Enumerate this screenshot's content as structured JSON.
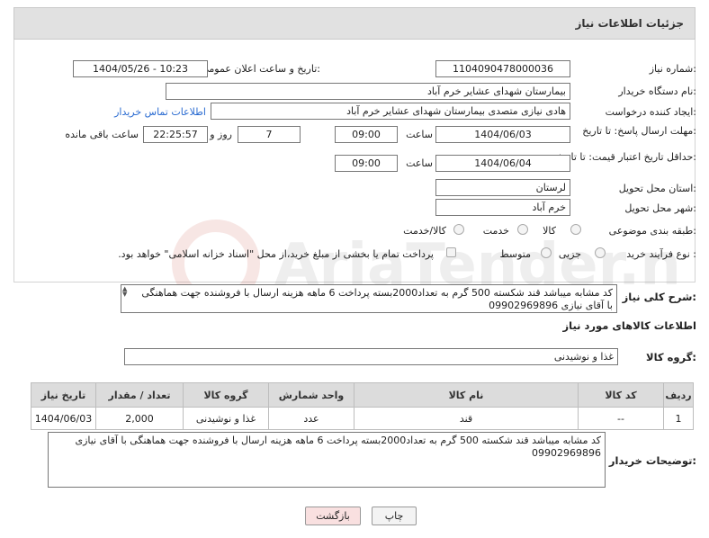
{
  "page": {
    "title": "جزئیات اطلاعات نیاز"
  },
  "fields": {
    "need_number_label": "شماره نیاز:",
    "need_number": "1104090478000036",
    "announce_label": "تاریخ و ساعت اعلان عمومی:",
    "announce_value": "1404/05/26 - 10:23",
    "buyer_label": "نام دستگاه خریدار:",
    "buyer_value": "بیمارستان شهدای عشایر خرم آباد",
    "creator_label": "ایجاد کننده درخواست:",
    "creator_value": "هادی نیازی متصدی بیمارستان شهدای عشایر خرم آباد",
    "contact_link": "اطلاعات تماس خریدار",
    "deadline_label": "مهلت ارسال پاسخ: تا تاریخ:",
    "deadline_date": "1404/06/03",
    "time_label": "ساعت",
    "deadline_time": "09:00",
    "days_value": "7",
    "days_label": "روز و",
    "remaining_time": "22:25:57",
    "remaining_label": "ساعت باقی مانده",
    "validity_label": "حداقل تاریخ اعتبار قیمت: تا تاریخ:",
    "validity_date": "1404/06/04",
    "validity_time": "09:00",
    "province_label": "استان محل تحویل:",
    "province_value": "لرستان",
    "city_label": "شهر محل تحویل:",
    "city_value": "خرم آباد",
    "category_label": "طبقه بندی موضوعی:",
    "category_options": [
      "کالا",
      "خدمت",
      "کالا/خدمت"
    ],
    "process_label": "نوع فرآیند خرید :",
    "process_options": [
      "جزیی",
      "متوسط"
    ],
    "payment_note": "پرداخت تمام یا بخشی از مبلغ خرید،از محل \"اسناد خزانه اسلامی\" خواهد بود."
  },
  "description": {
    "label": "شرح کلی نیاز:",
    "text": "کد مشابه میباشد قند شکسته 500 گرم به تعداد2000بسته   پرداخت 6 ماهه هزینه ارسال با فروشنده جهت هماهنگی با آقای نیازی 09902969896"
  },
  "goods": {
    "section_title": "اطلاعات کالاهای مورد نیاز",
    "group_label": "گروه کالا:",
    "group_value": "غذا و نوشیدنی",
    "table": {
      "headers": [
        "ردیف",
        "کد کالا",
        "نام کالا",
        "واحد شمارش",
        "گروه کالا",
        "تعداد / مقدار",
        "تاریخ نیاز"
      ],
      "rows": [
        [
          "1",
          "--",
          "قند",
          "عدد",
          "غذا و نوشیدنی",
          "2,000",
          "1404/06/03"
        ]
      ]
    }
  },
  "buyer_notes": {
    "label": "توضیحات خریدار:",
    "text": "کد مشابه میباشد قند شکسته 500 گرم به تعداد2000بسته   پرداخت 6 ماهه هزینه ارسال با فروشنده جهت هماهنگی با آقای نیازی 09902969896"
  },
  "buttons": {
    "print": "چاپ",
    "back": "بازگشت"
  },
  "watermark": {
    "text": "AriaTender.net"
  },
  "colors": {
    "header_bg": "#e1e1e1",
    "link": "#2a6bd1",
    "back_button_bg": "#f9e0e0"
  }
}
